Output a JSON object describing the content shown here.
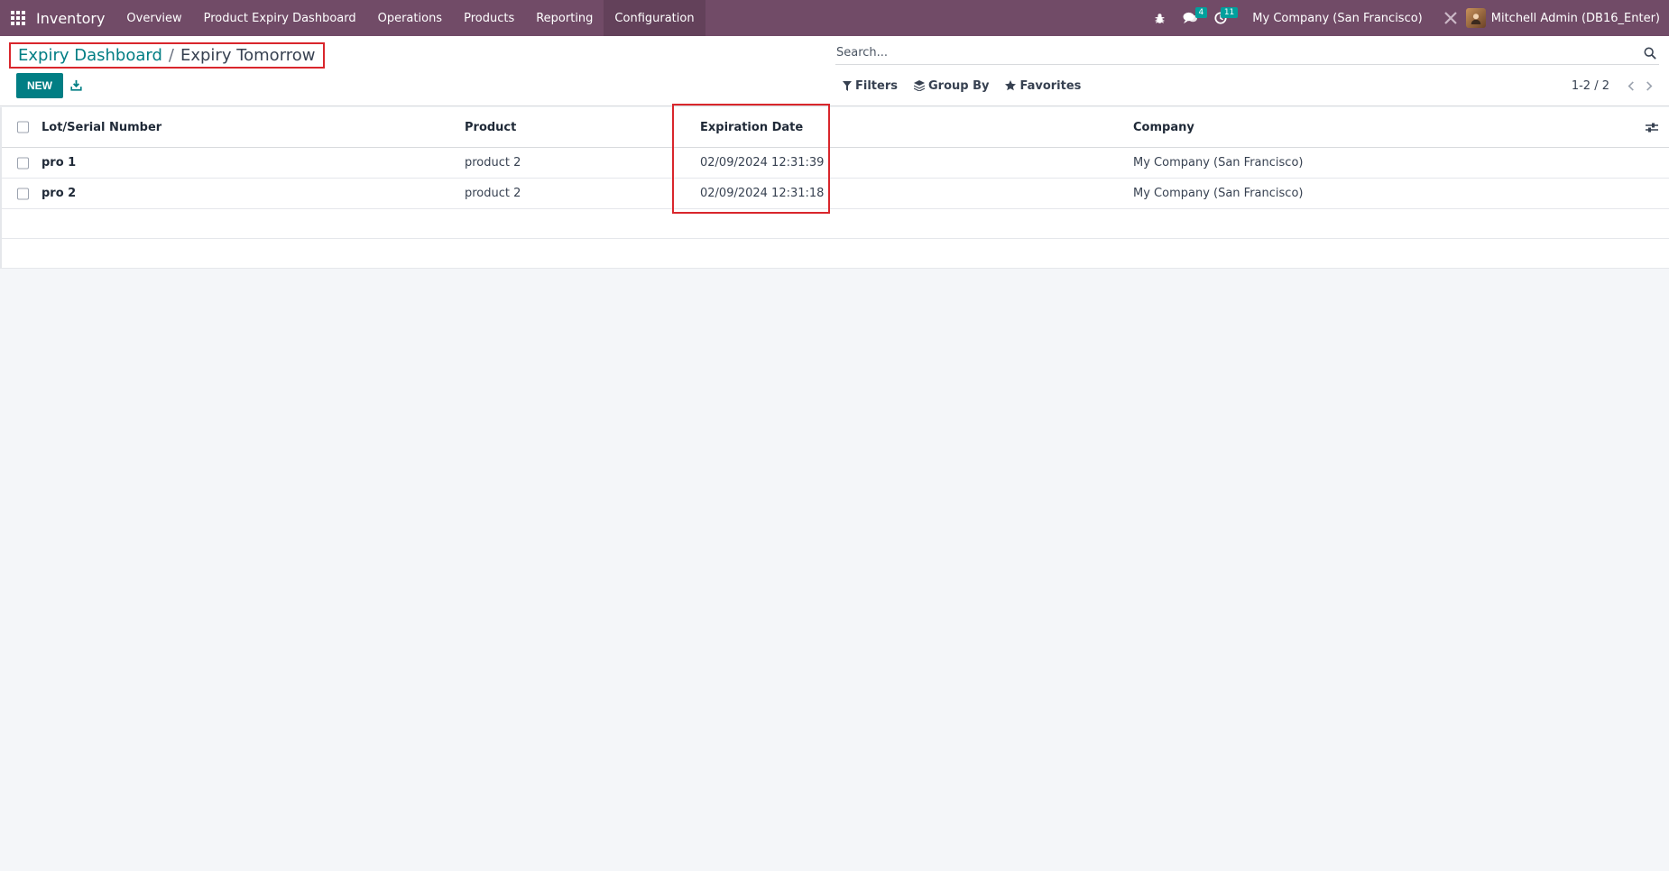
{
  "navbar": {
    "app_name": "Inventory",
    "menu": [
      "Overview",
      "Product Expiry Dashboard",
      "Operations",
      "Products",
      "Reporting",
      "Configuration"
    ],
    "active_menu": "Configuration",
    "messages_count": "4",
    "activities_count": "11",
    "company": "My Company (San Francisco)",
    "user": "Mitchell Admin (DB16_Enter)",
    "color": "#714b67"
  },
  "breadcrumb": {
    "parent": "Expiry Dashboard",
    "separator": "/",
    "current": "Expiry Tomorrow"
  },
  "toolbar": {
    "new_label": "NEW"
  },
  "search": {
    "placeholder": "Search..."
  },
  "filters": {
    "filters_label": "Filters",
    "group_by_label": "Group By",
    "favorites_label": "Favorites"
  },
  "pager": {
    "value": "1-2 / 2"
  },
  "table": {
    "columns": {
      "lot": "Lot/Serial Number",
      "product": "Product",
      "expiration": "Expiration Date",
      "company": "Company"
    },
    "rows": [
      {
        "lot": "pro 1",
        "product": "product 2",
        "expiration": "02/09/2024 12:31:39",
        "company": "My Company (San Francisco)"
      },
      {
        "lot": "pro 2",
        "product": "product 2",
        "expiration": "02/09/2024 12:31:18",
        "company": "My Company (San Francisco)"
      }
    ]
  },
  "colors": {
    "accent": "#017e84",
    "highlight": "#d9262c"
  }
}
